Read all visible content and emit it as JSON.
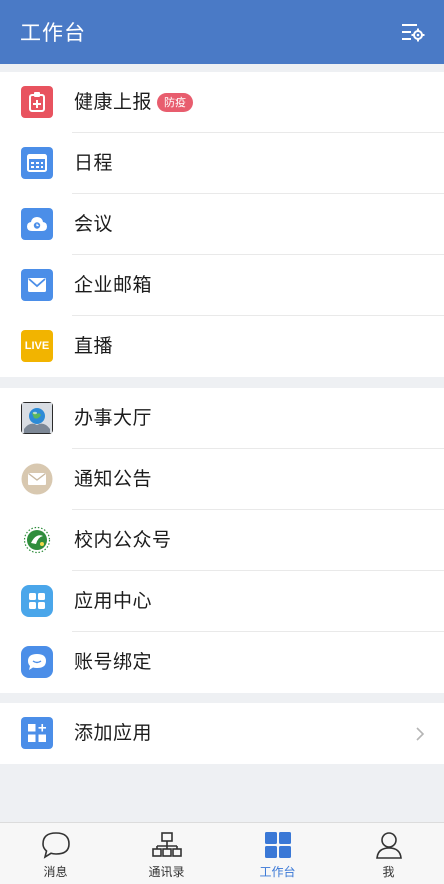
{
  "header": {
    "title": "工作台",
    "settings_icon": "list-settings-icon"
  },
  "group1": [
    {
      "label": "健康上报",
      "icon": "health-report-icon",
      "color": "#e8535f",
      "badge": "防疫"
    },
    {
      "label": "日程",
      "icon": "calendar-icon",
      "color": "#4b8ee8"
    },
    {
      "label": "会议",
      "icon": "cloud-meeting-icon",
      "color": "#4b8ee8"
    },
    {
      "label": "企业邮箱",
      "icon": "mail-icon",
      "color": "#4b8ee8"
    },
    {
      "label": "直播",
      "icon": "live-icon",
      "color": "#f2b400",
      "icon_text": "LIVE"
    }
  ],
  "group2": [
    {
      "label": "办事大厅",
      "icon": "globe-hands-icon"
    },
    {
      "label": "通知公告",
      "icon": "envelope-circle-icon"
    },
    {
      "label": "校内公众号",
      "icon": "school-logo-icon"
    },
    {
      "label": "应用中心",
      "icon": "app-center-icon",
      "color": "#4aa6ea"
    },
    {
      "label": "账号绑定",
      "icon": "chat-bubble-icon",
      "color": "#4b8ee8"
    }
  ],
  "group3": [
    {
      "label": "添加应用",
      "icon": "add-app-icon",
      "color": "#4b8ee8"
    }
  ],
  "bottom_nav": [
    {
      "label": "消息",
      "icon": "message-icon",
      "active": false
    },
    {
      "label": "通讯录",
      "icon": "contacts-icon",
      "active": false
    },
    {
      "label": "工作台",
      "icon": "workbench-icon",
      "active": true
    },
    {
      "label": "我",
      "icon": "profile-icon",
      "active": false
    }
  ],
  "colors": {
    "header": "#4a7ac6",
    "active": "#3a78d6"
  }
}
